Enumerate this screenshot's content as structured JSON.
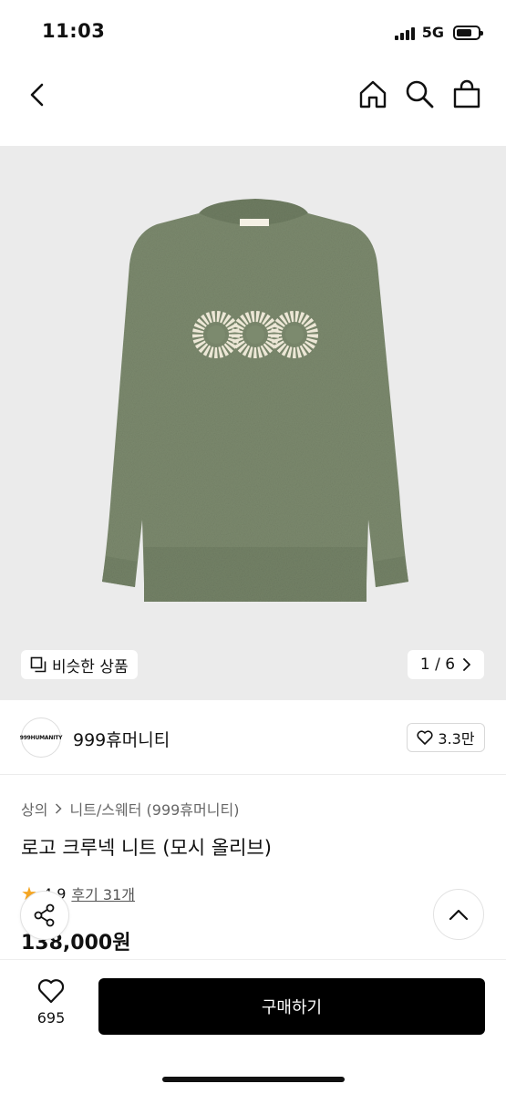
{
  "status_bar": {
    "time": "11:03",
    "network": "5G"
  },
  "nav": {
    "back_icon": "chevron-left-icon",
    "home_icon": "home-icon",
    "search_icon": "search-icon",
    "cart_icon": "shopping-bag-icon"
  },
  "gallery": {
    "similar_label": "비슷한 상품",
    "current_page": "1 / 6"
  },
  "brand": {
    "logo_text": "999HUMANITY",
    "name": "999휴머니티",
    "likes": "3.3만"
  },
  "product": {
    "breadcrumb_root": "상의",
    "breadcrumb_sub": "니트/스웨터 (999휴머니티)",
    "title": "로고 크루넥 니트 (모시 올리브)",
    "rating": "4.9",
    "review_label": "후기 31개",
    "price": "138,000원"
  },
  "bottom": {
    "wish_count": "695",
    "buy_label": "구매하기"
  },
  "colors": {
    "sweater": "#7c8a6e",
    "buy_button": "#000000",
    "star": "#f5a623"
  }
}
